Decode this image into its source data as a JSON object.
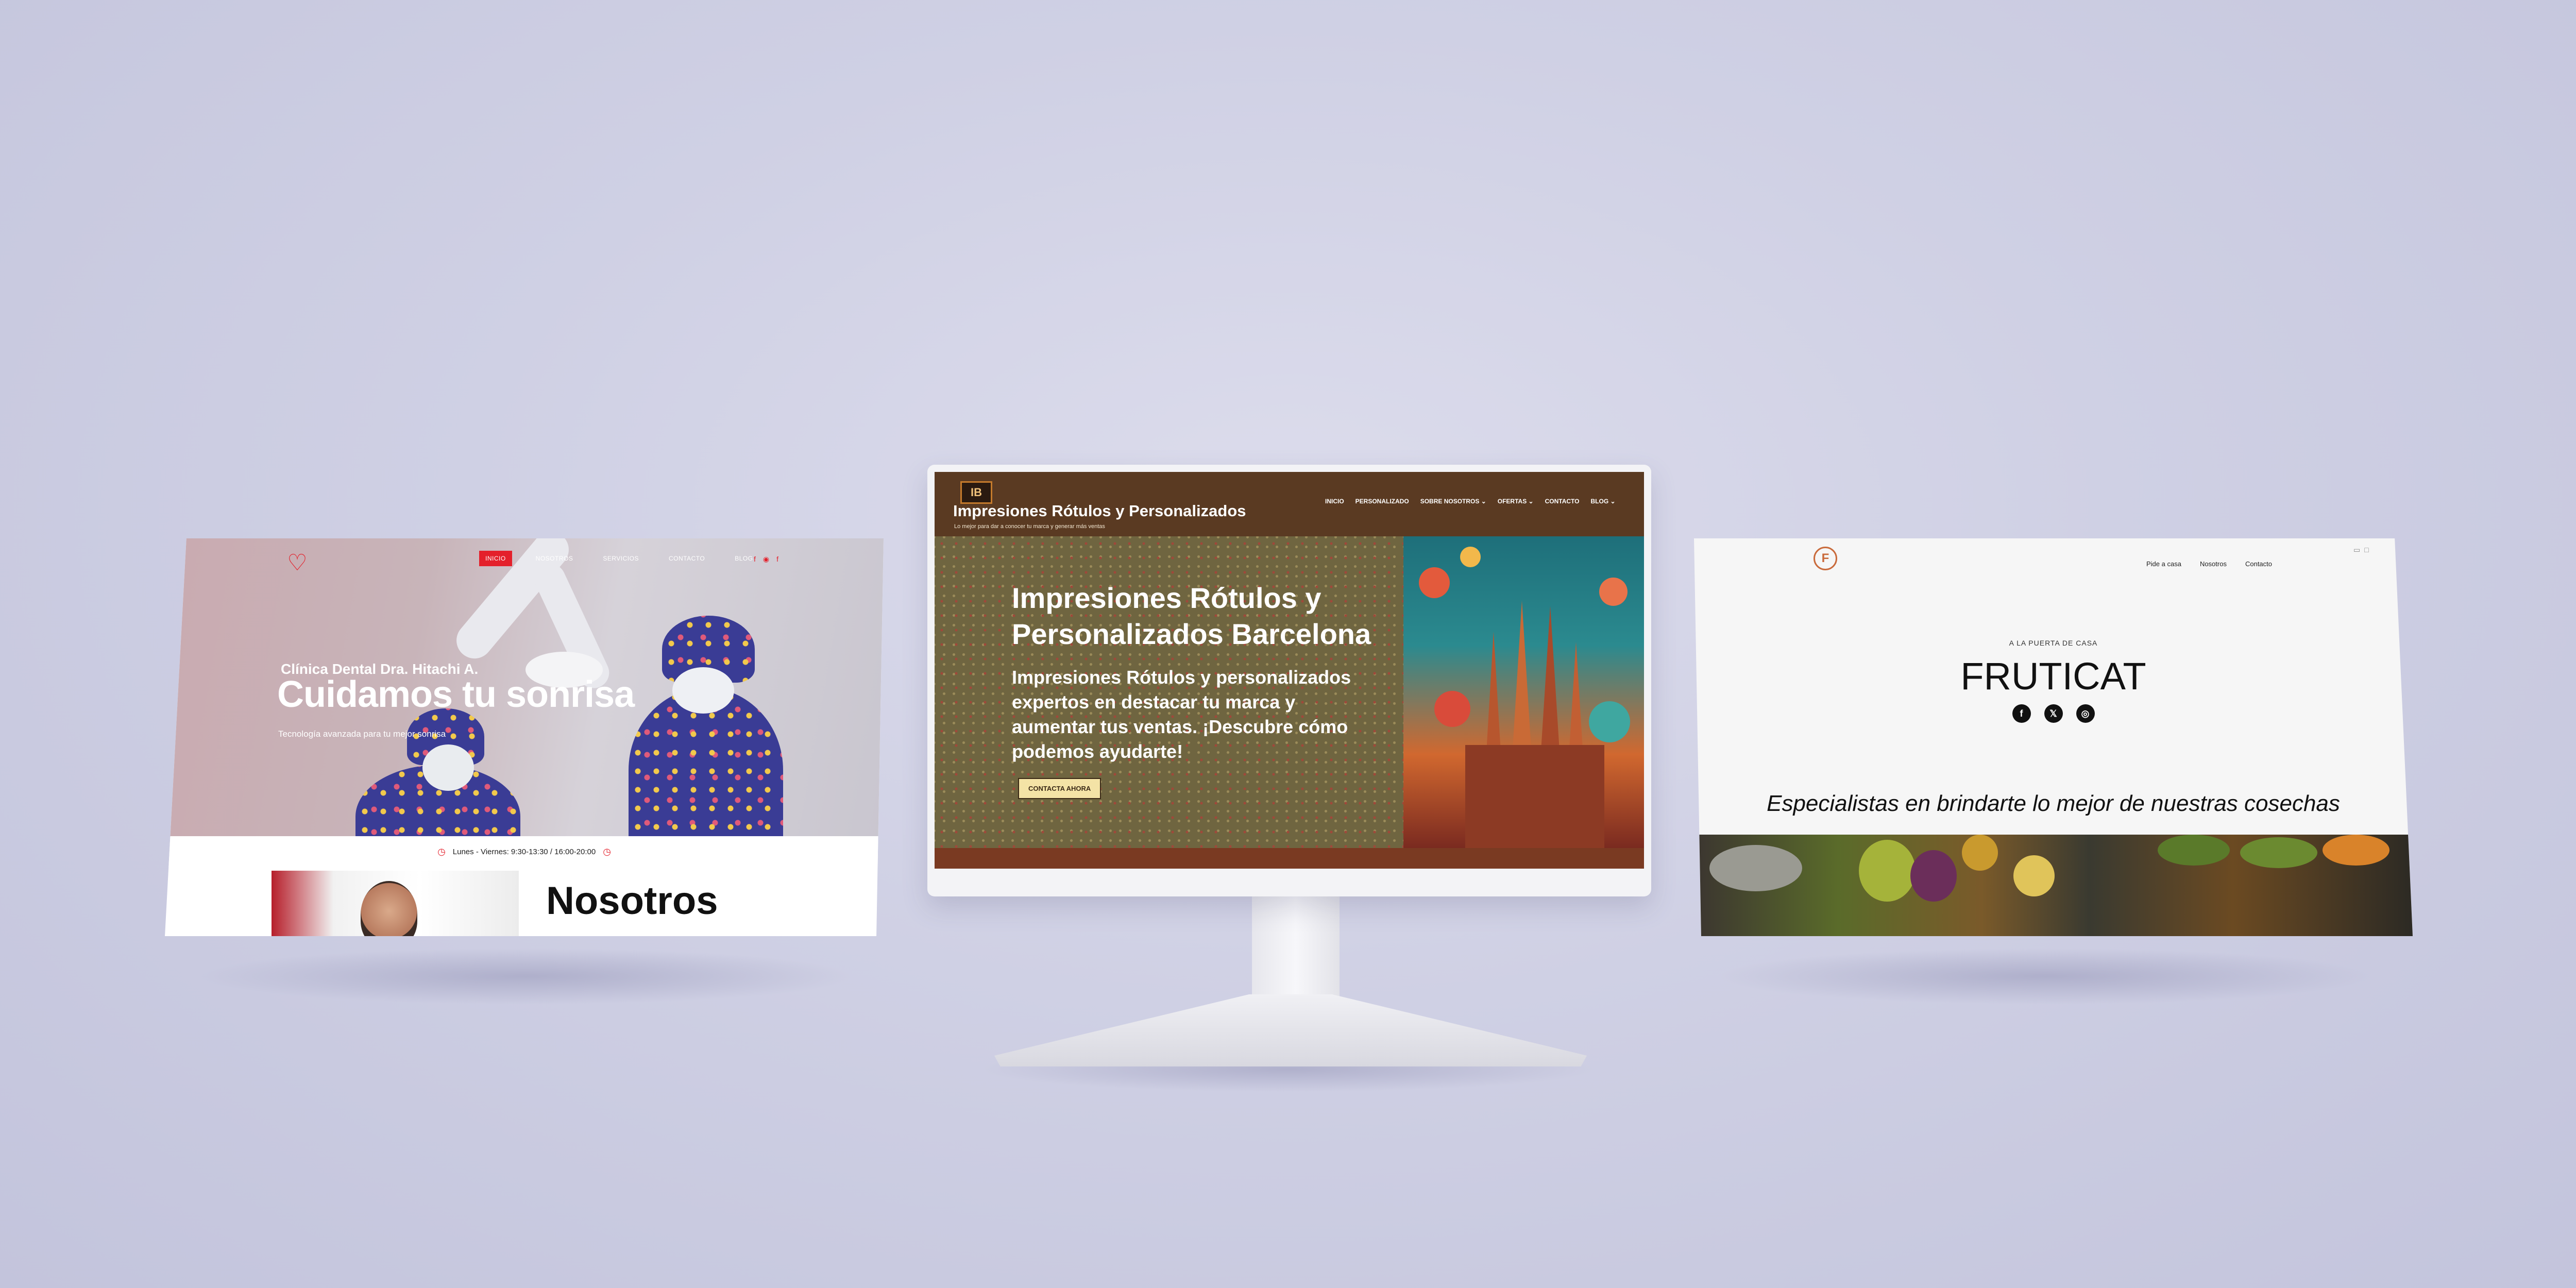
{
  "left_site": {
    "nav": [
      "INICIO",
      "NOSOTROS",
      "SERVICIOS",
      "CONTACTO",
      "BLOG"
    ],
    "social_icons": [
      "facebook-icon",
      "location-icon",
      "facebook-icon"
    ],
    "subtitle": "Clínica Dental Dra. Hitachi A.",
    "title": "Cuidamos tu sonrisa",
    "tagline": "Tecnología avanzada para tu mejor sonrisa",
    "hours": "Lunes - Viernes: 9:30-13:30 / 16:00-20:00",
    "about_title": "Nosotros",
    "accent": "#e4202b"
  },
  "center_site": {
    "brand": "Impresiones Rótulos y Personalizados",
    "brand_tagline": "Lo mejor para dar a conocer tu marca y generar más ventas",
    "nav": [
      "INICIO",
      "PERSONALIZADO",
      "SOBRE NOSOTROS ⌄",
      "OFERTAS ⌄",
      "CONTACTO",
      "BLOG ⌄"
    ],
    "hero_title": "Impresiones Rótulos y Personalizados Barcelona",
    "hero_text": "Impresiones Rótulos y personalizados expertos en destacar tu marca y aumentar tus ventas. ¡Descubre cómo podemos ayudarte!",
    "cta": "CONTACTA AHORA"
  },
  "right_site": {
    "nav": [
      "Pide a casa",
      "Nosotros",
      "Contacto"
    ],
    "kicker": "A LA PUERTA DE CASA",
    "title": "FRUTICAT",
    "social": [
      "f",
      "𝕏",
      "◎"
    ],
    "tagline": "Especialistas en brindarte lo mejor de nuestras cosechas"
  }
}
